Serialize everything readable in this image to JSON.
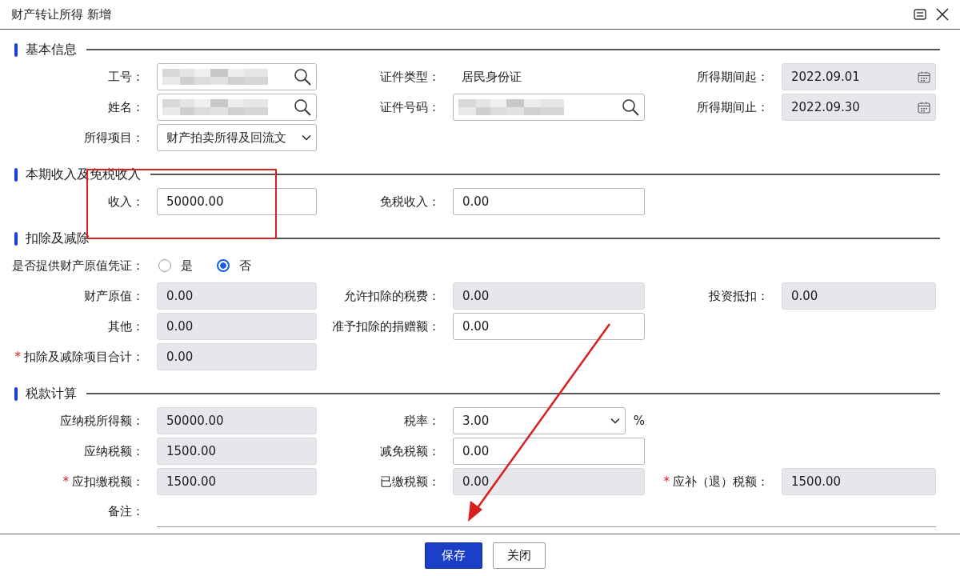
{
  "window": {
    "title": "财产转让所得 新增"
  },
  "sections": [
    {
      "title": "基本信息",
      "rows": [
        [
          {
            "label": "工号：",
            "kind": "search",
            "redacted": true
          },
          {
            "label": "证件类型：",
            "kind": "plain",
            "value": "居民身份证"
          },
          {
            "label": "所得期间起：",
            "kind": "date",
            "value": "2022.09.01",
            "readonly": true
          }
        ],
        [
          {
            "label": "姓名：",
            "kind": "search",
            "redacted": true
          },
          {
            "label": "证件号码：",
            "kind": "search",
            "redacted": true
          },
          {
            "label": "所得期间止：",
            "kind": "date",
            "value": "2022.09.30",
            "readonly": true
          }
        ],
        [
          {
            "label": "所得项目：",
            "kind": "select",
            "value": "财产拍卖所得及回流文"
          }
        ]
      ]
    },
    {
      "title": "本期收入及免税收入",
      "rows": [
        [
          {
            "label": "收入：",
            "kind": "text",
            "value": "50000.00"
          },
          {
            "label": "免税收入：",
            "kind": "text",
            "value": "0.00"
          }
        ]
      ]
    },
    {
      "title": "扣除及减除",
      "radio": {
        "label": "是否提供财产原值凭证：",
        "options": [
          {
            "label": "是",
            "selected": false
          },
          {
            "label": "否",
            "selected": true
          }
        ]
      },
      "rows": [
        [
          {
            "label": "财产原值：",
            "kind": "text",
            "value": "0.00",
            "readonly": true
          },
          {
            "label": "允许扣除的税费：",
            "kind": "text",
            "value": "0.00",
            "readonly": true
          },
          {
            "label": "投资抵扣：",
            "kind": "text",
            "value": "0.00",
            "readonly": true
          }
        ],
        [
          {
            "label": "其他：",
            "kind": "text",
            "value": "0.00",
            "readonly": true
          },
          {
            "label": "准予扣除的捐赠额：",
            "kind": "text",
            "value": "0.00"
          }
        ],
        [
          {
            "label": "扣除及减除项目合计：",
            "required_mark": "*",
            "kind": "text",
            "value": "0.00",
            "readonly": true
          }
        ]
      ]
    },
    {
      "title": "税款计算",
      "rows": [
        [
          {
            "label": "应纳税所得额：",
            "kind": "text",
            "value": "50000.00",
            "readonly": true
          },
          {
            "label": "税率：",
            "kind": "select",
            "value": "3.00",
            "unit": "%"
          }
        ],
        [
          {
            "label": "应纳税额：",
            "kind": "text",
            "value": "1500.00",
            "readonly": true
          },
          {
            "label": "减免税额：",
            "kind": "text",
            "value": "0.00"
          }
        ],
        [
          {
            "label": "应扣缴税额：",
            "required_mark": "*",
            "kind": "text",
            "value": "1500.00",
            "readonly": true
          },
          {
            "label": "已缴税额：",
            "kind": "text",
            "value": "0.00",
            "readonly": true
          },
          {
            "label": "应补（退）税额：",
            "required_mark": "*",
            "kind": "text",
            "value": "1500.00",
            "readonly": true
          }
        ]
      ],
      "note": {
        "label": "备注："
      }
    }
  ],
  "buttons": [
    {
      "label": "保存",
      "kind": "primary"
    },
    {
      "label": "关闭",
      "kind": "default"
    }
  ],
  "annotations": {
    "highlight_box": true,
    "arrow": true
  }
}
